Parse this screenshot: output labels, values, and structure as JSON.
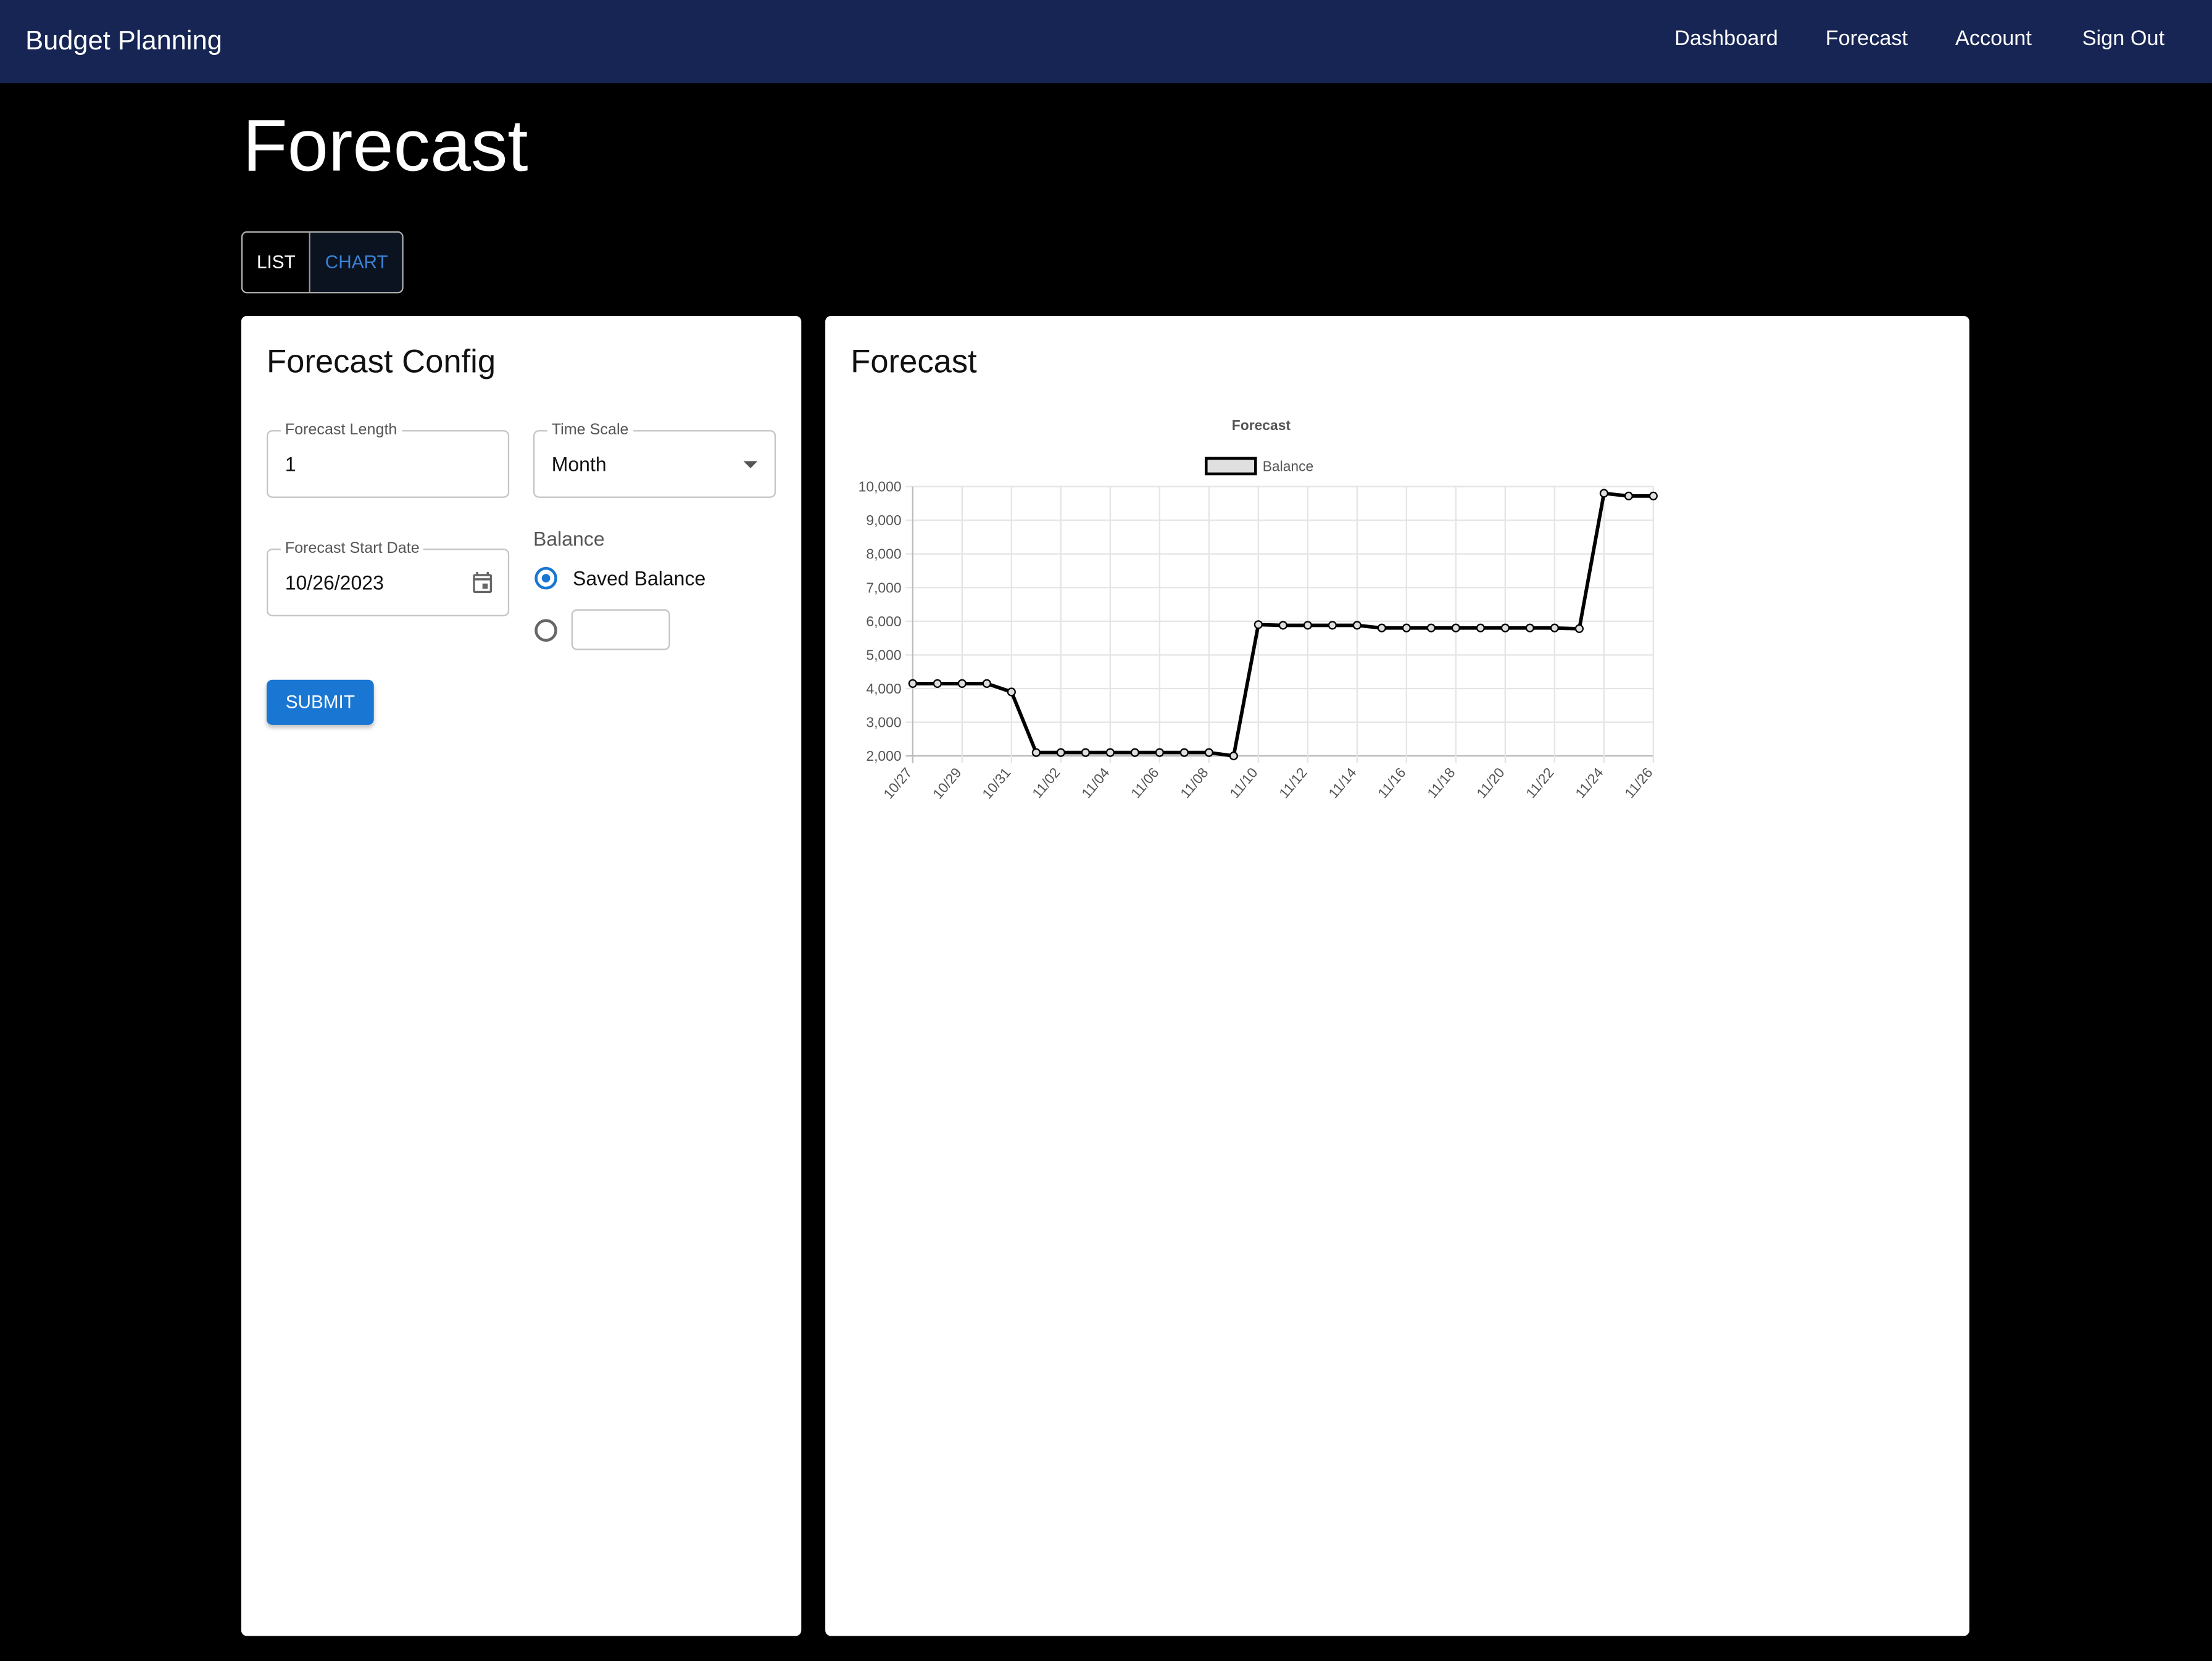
{
  "app": {
    "brand": "Budget Planning",
    "nav": [
      {
        "label": "Dashboard"
      },
      {
        "label": "Forecast"
      },
      {
        "label": "Account"
      },
      {
        "label": "Sign Out"
      }
    ]
  },
  "page": {
    "title": "Forecast",
    "view_toggle": {
      "list": "LIST",
      "chart": "CHART",
      "selected": "CHART"
    }
  },
  "config": {
    "title": "Forecast Config",
    "forecast_length": {
      "label": "Forecast Length",
      "value": "1"
    },
    "time_scale": {
      "label": "Time Scale",
      "value": "Month"
    },
    "start_date": {
      "label": "Forecast Start Date",
      "value": "10/26/2023"
    },
    "balance": {
      "label": "Balance",
      "saved_option": "Saved Balance",
      "selected": "Saved Balance",
      "custom_value": ""
    },
    "submit": "SUBMIT"
  },
  "forecast_panel": {
    "title": "Forecast"
  },
  "colors": {
    "topbar": "#172554",
    "accent": "#1976d2",
    "line": "#000000",
    "legend_fill": "#e0e0e0"
  },
  "chart_data": {
    "type": "line",
    "title": "Forecast",
    "legend_position": "top",
    "grid": true,
    "ylim": [
      2000,
      10000
    ],
    "yticks": [
      "2,000",
      "3,000",
      "4,000",
      "5,000",
      "6,000",
      "7,000",
      "8,000",
      "9,000",
      "10,000"
    ],
    "xticks": [
      "10/27",
      "10/29",
      "10/31",
      "11/02",
      "11/04",
      "11/06",
      "11/08",
      "11/10",
      "11/12",
      "11/14",
      "11/16",
      "11/18",
      "11/20",
      "11/22",
      "11/24",
      "11/26"
    ],
    "x": [
      "10/27",
      "10/28",
      "10/29",
      "10/30",
      "10/31",
      "11/01",
      "11/02",
      "11/03",
      "11/04",
      "11/05",
      "11/06",
      "11/07",
      "11/08",
      "11/09",
      "11/10",
      "11/11",
      "11/12",
      "11/13",
      "11/14",
      "11/15",
      "11/16",
      "11/17",
      "11/18",
      "11/19",
      "11/20",
      "11/21",
      "11/22",
      "11/23",
      "11/24",
      "11/25",
      "11/26"
    ],
    "series": [
      {
        "name": "Balance",
        "values": [
          4150,
          4150,
          4150,
          4150,
          3900,
          2100,
          2100,
          2100,
          2100,
          2100,
          2100,
          2100,
          2100,
          2000,
          5900,
          5880,
          5880,
          5880,
          5880,
          5800,
          5800,
          5800,
          5800,
          5800,
          5800,
          5800,
          5800,
          5780,
          9800,
          9720,
          9720
        ]
      }
    ]
  }
}
